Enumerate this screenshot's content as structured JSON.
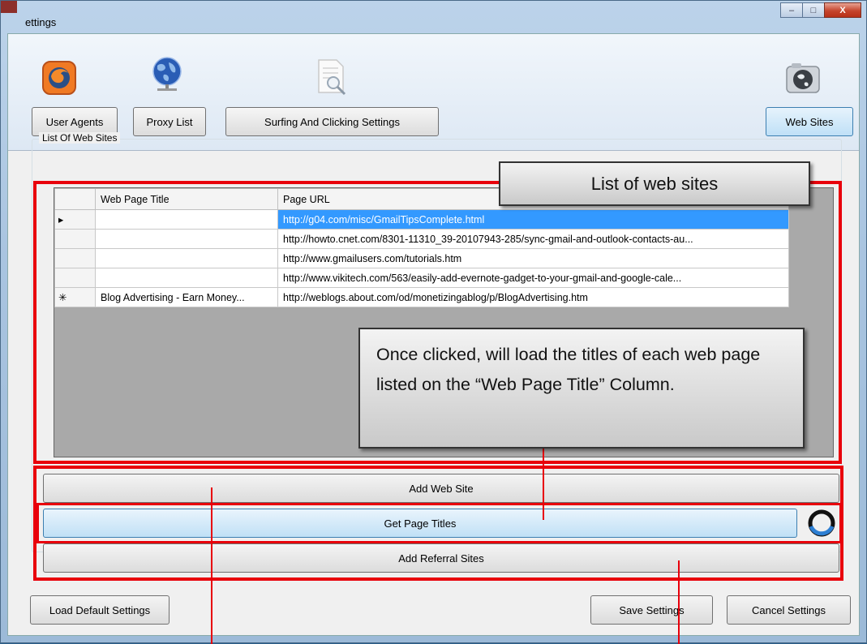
{
  "window": {
    "title": "ettings",
    "minimize_glyph": "–",
    "maximize_glyph": "□",
    "close_glyph": "X"
  },
  "toolbar": {
    "buttons": [
      {
        "label": "User Agents",
        "icon": "firefox-icon"
      },
      {
        "label": "Proxy List",
        "icon": "globe-network-icon"
      },
      {
        "label": "Surfing And Clicking Settings",
        "icon": "document-search-icon"
      },
      {
        "label": "Web Sites",
        "icon": "globe-camera-icon"
      }
    ]
  },
  "group": {
    "title": "List Of Web Sites"
  },
  "grid": {
    "columns": [
      "Web Page Title",
      "Page URL"
    ],
    "rows": [
      {
        "marker": "▸",
        "title": "",
        "url": "http://g04.com/misc/GmailTipsComplete.html",
        "selected": true
      },
      {
        "marker": "",
        "title": "",
        "url": "http://howto.cnet.com/8301-11310_39-20107943-285/sync-gmail-and-outlook-contacts-au...",
        "selected": false
      },
      {
        "marker": "",
        "title": "",
        "url": "http://www.gmailusers.com/tutorials.htm",
        "selected": false
      },
      {
        "marker": "",
        "title": "",
        "url": "http://www.vikitech.com/563/easily-add-evernote-gadget-to-your-gmail-and-google-cale...",
        "selected": false
      },
      {
        "marker": "✳",
        "title": "Blog Advertising - Earn Money...",
        "url": "http://weblogs.about.com/od/monetizingablog/p/BlogAdvertising.htm",
        "selected": false
      }
    ]
  },
  "actions": {
    "add_web_site": "Add Web Site",
    "get_page_titles": "Get Page Titles",
    "add_referral_sites": "Add Referral Sites"
  },
  "footer": {
    "load_default": "Load Default Settings",
    "save": "Save Settings",
    "cancel": "Cancel Settings"
  },
  "annotations": {
    "list_callout": "List of web sites",
    "titles_callout": "Once clicked, will load the titles of each web page listed on the “Web Page Title” Column."
  },
  "colors": {
    "annotation_red": "#e8000b",
    "selection_blue": "#3399ff"
  }
}
